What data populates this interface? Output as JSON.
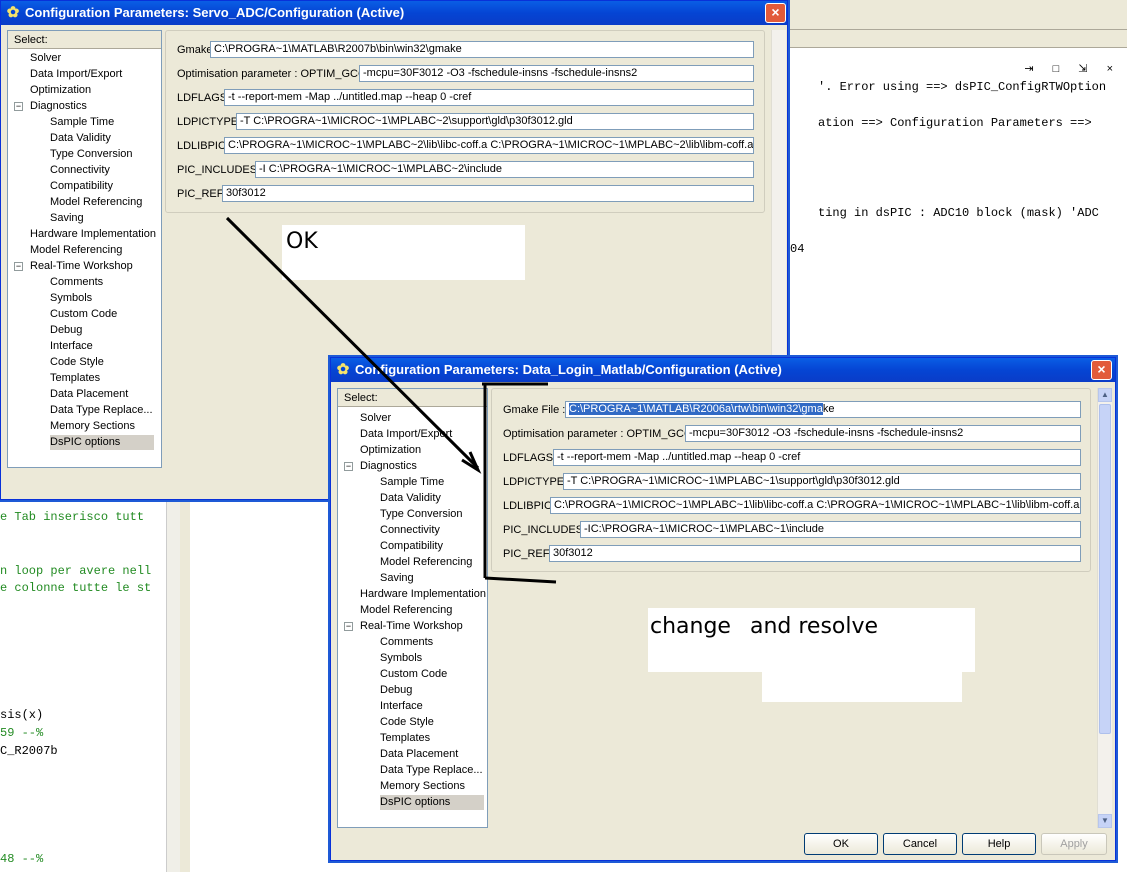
{
  "background": {
    "console_lines_top": [
      "'. Error using ==> dsPIC_ConfigRTWOption",
      "ation ==> Configuration Parameters ==>",
      "ting in dsPIC : ADC10 block (mask) 'ADC",
      "04"
    ],
    "console_lines_left": [
      {
        "text": "e Tab inserisco tutt",
        "green": true
      },
      {
        "text": "n loop per avere nell",
        "green": true
      },
      {
        "text": "e colonne tutte le st",
        "green": true
      },
      {
        "text": "sis(x)",
        "green": false
      },
      {
        "text": "59 --%",
        "green": true
      },
      {
        "text": "C_R2007b",
        "green": false
      },
      {
        "text": "48 --%",
        "green": true
      }
    ],
    "window_controls": "⇥ □ ⇲ ×"
  },
  "dialog1": {
    "title": "Configuration Parameters: Servo_ADC/Configuration (Active)",
    "select_label": "Select:",
    "tree": [
      {
        "label": "Solver",
        "level": 1
      },
      {
        "label": "Data Import/Export",
        "level": 1
      },
      {
        "label": "Optimization",
        "level": 1
      },
      {
        "label": "Diagnostics",
        "level": 1,
        "expander": "−"
      },
      {
        "label": "Sample Time",
        "level": 2
      },
      {
        "label": "Data Validity",
        "level": 2
      },
      {
        "label": "Type Conversion",
        "level": 2
      },
      {
        "label": "Connectivity",
        "level": 2
      },
      {
        "label": "Compatibility",
        "level": 2
      },
      {
        "label": "Model Referencing",
        "level": 2
      },
      {
        "label": "Saving",
        "level": 2
      },
      {
        "label": "Hardware Implementation",
        "level": 1
      },
      {
        "label": "Model Referencing",
        "level": 1
      },
      {
        "label": "Real-Time Workshop",
        "level": 1,
        "expander": "−"
      },
      {
        "label": "Comments",
        "level": 2
      },
      {
        "label": "Symbols",
        "level": 2
      },
      {
        "label": "Custom Code",
        "level": 2
      },
      {
        "label": "Debug",
        "level": 2
      },
      {
        "label": "Interface",
        "level": 2
      },
      {
        "label": "Code Style",
        "level": 2
      },
      {
        "label": "Templates",
        "level": 2
      },
      {
        "label": "Data Placement",
        "level": 2
      },
      {
        "label": "Data Type Replace...",
        "level": 2
      },
      {
        "label": "Memory Sections",
        "level": 2
      },
      {
        "label": "DsPIC options",
        "level": 2,
        "selected": true
      }
    ],
    "fields": [
      {
        "label": "Gmake File :",
        "value": "C:\\PROGRA~1\\MATLAB\\R2007b\\bin\\win32\\gmake"
      },
      {
        "label": "Optimisation parameter : OPTIM_GCC",
        "value": "-mcpu=30F3012 -O3 -fschedule-insns -fschedule-insns2"
      },
      {
        "label": "LDFLAGS",
        "value": "-t --report-mem -Map ../untitled.map --heap 0  -cref"
      },
      {
        "label": "LDPICTYPE",
        "value": "-T C:\\PROGRA~1\\MICROC~1\\MPLABC~2\\support\\gld\\p30f3012.gld"
      },
      {
        "label": "LDLIBPIC",
        "value": "C:\\PROGRA~1\\MICROC~1\\MPLABC~2\\lib\\libc-coff.a C:\\PROGRA~1\\MICROC~1\\MPLABC~2\\lib\\libm-coff.a"
      },
      {
        "label": "PIC_INCLUDES",
        "value": "-I C:\\PROGRA~1\\MICROC~1\\MPLABC~2\\include"
      },
      {
        "label": "PIC_REF",
        "value": "30f3012"
      }
    ]
  },
  "dialog2": {
    "title": "Configuration Parameters: Data_Login_Matlab/Configuration (Active)",
    "select_label": "Select:",
    "tree": [
      {
        "label": "Solver",
        "level": 1
      },
      {
        "label": "Data Import/Export",
        "level": 1
      },
      {
        "label": "Optimization",
        "level": 1
      },
      {
        "label": "Diagnostics",
        "level": 1,
        "expander": "−"
      },
      {
        "label": "Sample Time",
        "level": 2
      },
      {
        "label": "Data Validity",
        "level": 2
      },
      {
        "label": "Type Conversion",
        "level": 2
      },
      {
        "label": "Connectivity",
        "level": 2
      },
      {
        "label": "Compatibility",
        "level": 2
      },
      {
        "label": "Model Referencing",
        "level": 2
      },
      {
        "label": "Saving",
        "level": 2
      },
      {
        "label": "Hardware Implementation",
        "level": 1
      },
      {
        "label": "Model Referencing",
        "level": 1
      },
      {
        "label": "Real-Time Workshop",
        "level": 1,
        "expander": "−"
      },
      {
        "label": "Comments",
        "level": 2
      },
      {
        "label": "Symbols",
        "level": 2
      },
      {
        "label": "Custom Code",
        "level": 2
      },
      {
        "label": "Debug",
        "level": 2
      },
      {
        "label": "Interface",
        "level": 2
      },
      {
        "label": "Code Style",
        "level": 2
      },
      {
        "label": "Templates",
        "level": 2
      },
      {
        "label": "Data Placement",
        "level": 2
      },
      {
        "label": "Data Type Replace...",
        "level": 2
      },
      {
        "label": "Memory Sections",
        "level": 2
      },
      {
        "label": "DsPIC options",
        "level": 2,
        "selected": true
      }
    ],
    "gmake_label": "Gmake File :",
    "gmake_selected": "C:\\PROGRA~1\\MATLAB\\R2006a\\rtw\\bin\\win32\\gma",
    "gmake_rest": "ke",
    "fields": [
      {
        "label": "Optimisation parameter : OPTIM_GCC",
        "value": "-mcpu=30F3012 -O3 -fschedule-insns -fschedule-insns2"
      },
      {
        "label": "LDFLAGS",
        "value": "-t --report-mem -Map ../untitled.map --heap 0  -cref"
      },
      {
        "label": "LDPICTYPE",
        "value": "-T C:\\PROGRA~1\\MICROC~1\\MPLABC~1\\support\\gld\\p30f3012.gld"
      },
      {
        "label": "LDLIBPIC",
        "value": "C:\\PROGRA~1\\MICROC~1\\MPLABC~1\\lib\\libc-coff.a C:\\PROGRA~1\\MICROC~1\\MPLABC~1\\lib\\libm-coff.a"
      },
      {
        "label": "PIC_INCLUDES",
        "value": "-IC:\\PROGRA~1\\MICROC~1\\MPLABC~1\\include"
      },
      {
        "label": "PIC_REF",
        "value": "30f3012"
      }
    ],
    "buttons": {
      "ok": "OK",
      "cancel": "Cancel",
      "help": "Help",
      "apply": "Apply"
    }
  },
  "annotations": {
    "ok": "OK",
    "change": "change",
    "resolve": "and resolve"
  },
  "icons": {
    "close": "×",
    "title_icon": "✿"
  }
}
